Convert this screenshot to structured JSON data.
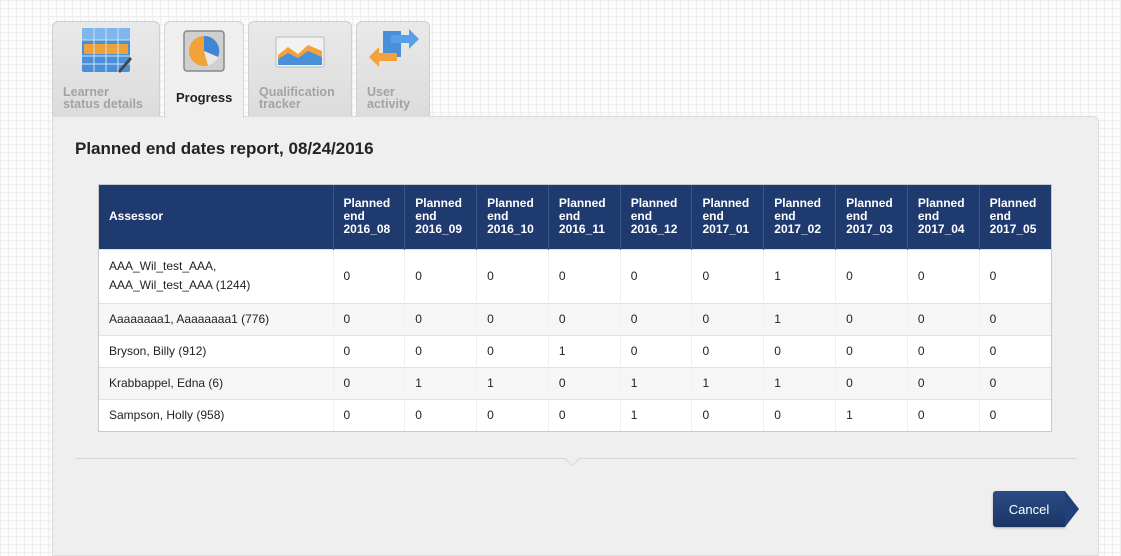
{
  "tabs": [
    {
      "label": "Learner\nstatus details",
      "icon": "grid-icon",
      "active": false
    },
    {
      "label": "Progress",
      "icon": "pie-chart-icon",
      "active": true
    },
    {
      "label": "Qualification\ntracker",
      "icon": "area-chart-icon",
      "active": false
    },
    {
      "label": "User\nactivity",
      "icon": "arrows-icon",
      "active": false
    }
  ],
  "report": {
    "title": "Planned end dates report, 08/24/2016",
    "columns": [
      "Assessor",
      "Planned\nend\n2016_08",
      "Planned\nend\n2016_09",
      "Planned\nend\n2016_10",
      "Planned\nend\n2016_11",
      "Planned\nend\n2016_12",
      "Planned\nend\n2017_01",
      "Planned\nend\n2017_02",
      "Planned\nend\n2017_03",
      "Planned\nend\n2017_04",
      "Planned\nend\n2017_05"
    ],
    "rows": [
      {
        "assessor": "AAA_Wil_test_AAA,\nAAA_Wil_test_AAA (1244)",
        "values": [
          "0",
          "0",
          "0",
          "0",
          "0",
          "0",
          "1",
          "0",
          "0",
          "0"
        ]
      },
      {
        "assessor": "Aaaaaaaa1, Aaaaaaaa1 (776)",
        "values": [
          "0",
          "0",
          "0",
          "0",
          "0",
          "0",
          "1",
          "0",
          "0",
          "0"
        ]
      },
      {
        "assessor": "Bryson, Billy (912)",
        "values": [
          "0",
          "0",
          "0",
          "1",
          "0",
          "0",
          "0",
          "0",
          "0",
          "0"
        ]
      },
      {
        "assessor": "Krabbappel, Edna (6)",
        "values": [
          "0",
          "1",
          "1",
          "0",
          "1",
          "1",
          "1",
          "0",
          "0",
          "0"
        ]
      },
      {
        "assessor": "Sampson, Holly (958)",
        "values": [
          "0",
          "0",
          "0",
          "0",
          "1",
          "0",
          "0",
          "1",
          "0",
          "0"
        ]
      }
    ]
  },
  "actions": {
    "cancel_label": "Cancel"
  },
  "colors": {
    "header": "#1f3a6f",
    "button": "#1f3a6f"
  }
}
